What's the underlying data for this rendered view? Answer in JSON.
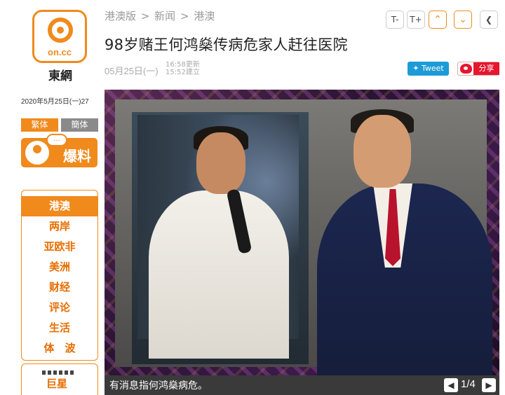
{
  "logo": {
    "text": "on.cc",
    "site_name": "東網"
  },
  "sidebar": {
    "date": "2020年5月25日(一)27",
    "lang": {
      "traditional": "繁体",
      "simplified": "簡体"
    },
    "tip_label": "爆料",
    "tip_bubble": "...",
    "nav": [
      {
        "label": "港澳",
        "active": true
      },
      {
        "label": "两岸"
      },
      {
        "label": "亚欧非"
      },
      {
        "label": "美洲"
      },
      {
        "label": "财经"
      },
      {
        "label": "评论"
      },
      {
        "label": "生活"
      },
      {
        "label": "体　波"
      }
    ],
    "star_label": "巨星"
  },
  "breadcrumb": [
    "港澳版",
    ">",
    "新闻",
    ">",
    "港澳"
  ],
  "toolbar": {
    "font_smaller": "T-",
    "font_larger": "T+",
    "prev_icon": "chevron-up-icon",
    "next_icon": "chevron-down-icon",
    "back_icon": "chevron-left-icon"
  },
  "article": {
    "title": "98岁赌王何鸿燊传病危家人赶往医院",
    "date": "05月25日(一)",
    "updated": "16:58更新",
    "created": "15:52建立"
  },
  "share": {
    "tweet": "Tweet",
    "share": "分享"
  },
  "gallery": {
    "caption": "有消息指何鸿燊病危。",
    "pager": "1/4"
  },
  "colors": {
    "accent": "#f08a1c",
    "twitter": "#1d9bd6",
    "weibo": "#e6162d"
  }
}
